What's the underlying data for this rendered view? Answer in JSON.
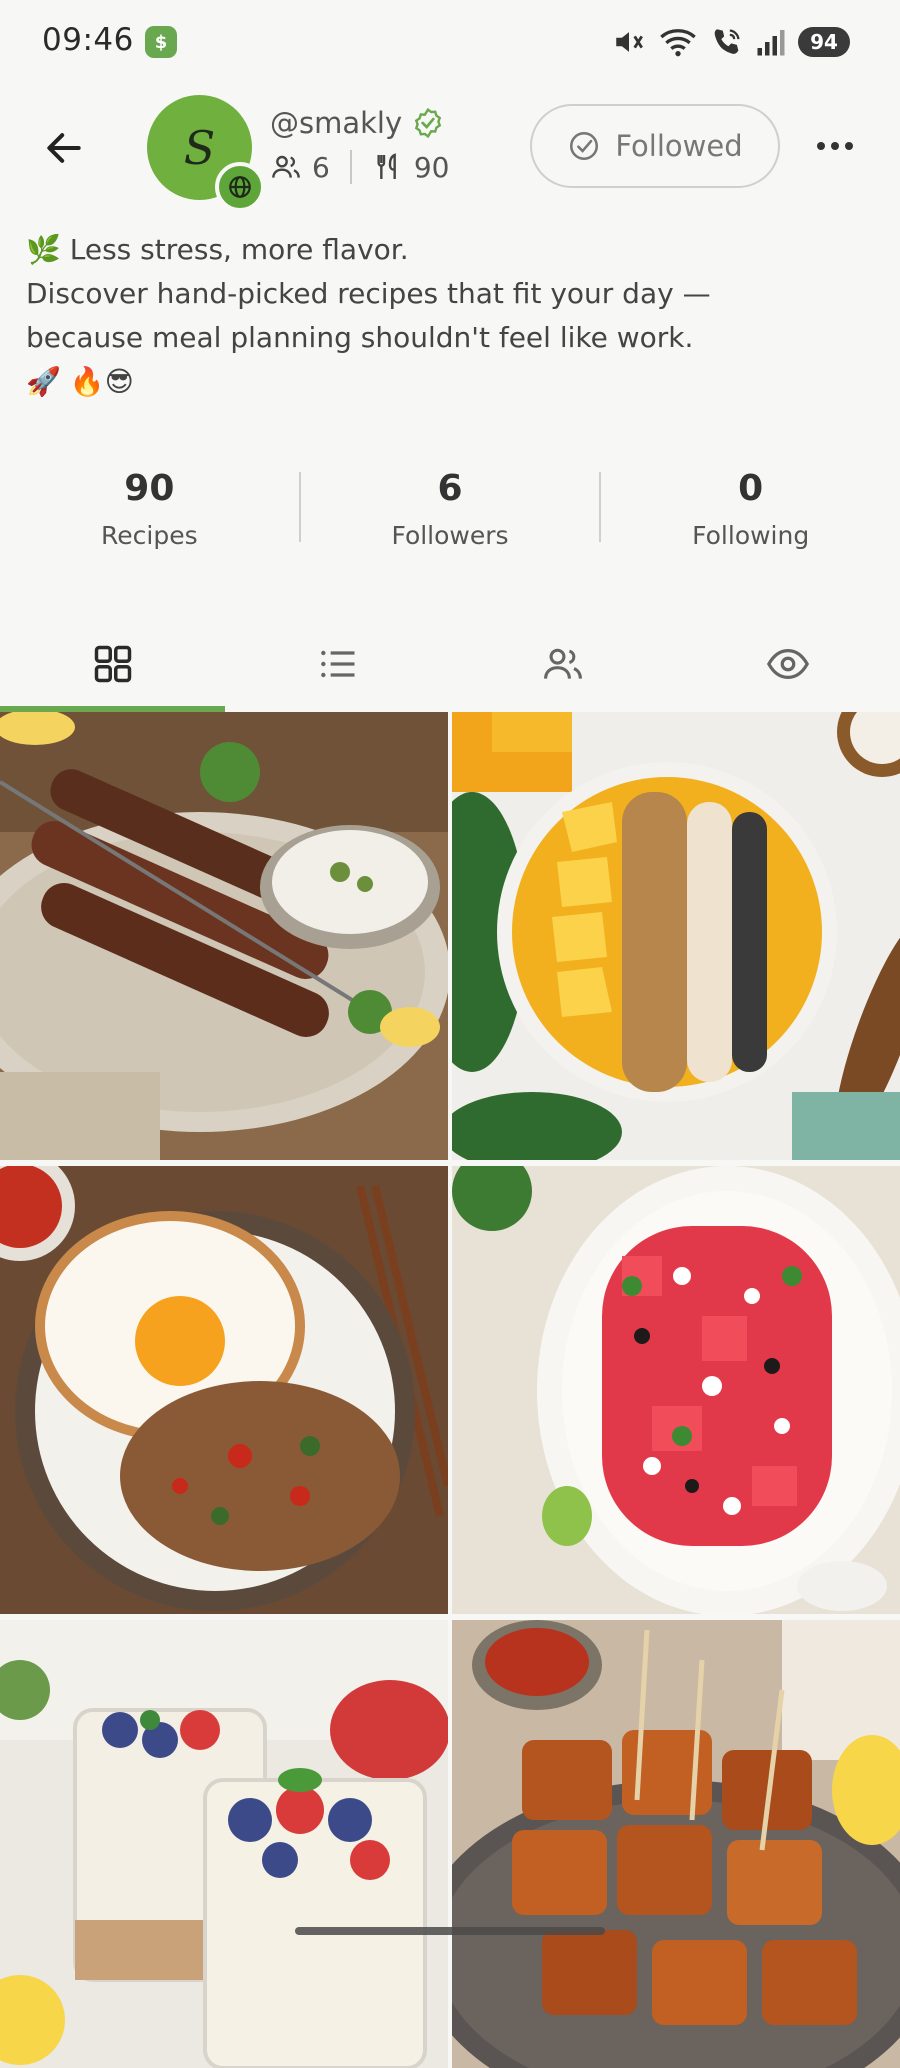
{
  "status_bar": {
    "time": "09:46",
    "battery": "94",
    "icons": [
      "mute-icon",
      "wifi-icon",
      "wifi-call-icon",
      "signal-icon"
    ]
  },
  "profile": {
    "username": "@smakly",
    "avatar_letter": "S",
    "followers_count": "6",
    "recipes_count": "90",
    "follow_label": "Followed"
  },
  "bio": {
    "lines": [
      "🌿 Less stress, more flavor.",
      "Discover hand-picked recipes that fit your day —",
      "because meal planning shouldn't feel like work.",
      "🚀 🔥😎"
    ]
  },
  "stats": [
    {
      "value": "90",
      "label": "Recipes"
    },
    {
      "value": "6",
      "label": "Followers"
    },
    {
      "value": "0",
      "label": "Following"
    }
  ],
  "tabs": [
    {
      "icon": "grid-icon",
      "active": true
    },
    {
      "icon": "list-icon",
      "active": false
    },
    {
      "icon": "people-icon",
      "active": false
    },
    {
      "icon": "eye-icon",
      "active": false
    }
  ],
  "colors": {
    "accent": "#6aa84f",
    "background": "#f7f7f5"
  },
  "recipes": [
    {
      "dish": "kebab-skewers-photo"
    },
    {
      "dish": "mango-smoothie-bowl-photo"
    },
    {
      "dish": "fried-egg-rice-bowl-photo"
    },
    {
      "dish": "watermelon-feta-salad-photo"
    },
    {
      "dish": "berry-parfait-photo"
    },
    {
      "dish": "glazed-tofu-skewers-photo"
    }
  ]
}
